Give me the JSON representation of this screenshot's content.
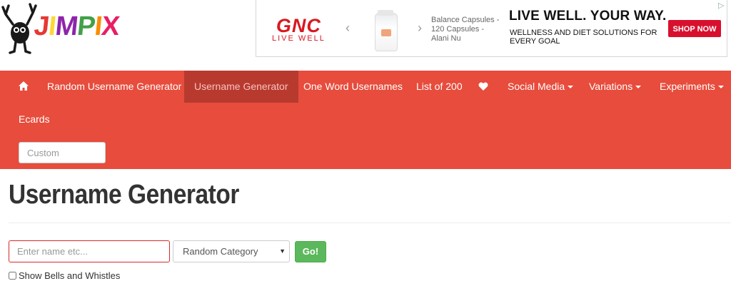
{
  "logo": {
    "letters": [
      "J",
      "I",
      "M",
      "P",
      "I",
      "X"
    ]
  },
  "ad": {
    "brand_main": "GNC",
    "brand_sub": "LIVE WELL",
    "product": "Balance Capsules - 120 Capsules - Alani Nu",
    "headline": "LIVE WELL. YOUR WAY.",
    "subline": "WELLNESS AND DIET SOLUTIONS FOR EVERY GOAL",
    "cta": "SHOP NOW",
    "brand_color": "#d71920"
  },
  "nav": {
    "items": [
      {
        "label": "Random Username Generator"
      },
      {
        "label": "Username Generator"
      },
      {
        "label": "One Word Usernames"
      },
      {
        "label": "List of 200"
      },
      {
        "label": "Social Media"
      },
      {
        "label": "Variations"
      },
      {
        "label": "Experiments"
      },
      {
        "label": "Ecards"
      }
    ],
    "custom_placeholder": "Custom",
    "bg_color": "#e74c3c",
    "active_color": "#b83a2f"
  },
  "main": {
    "title": "Username Generator",
    "name_placeholder": "Enter name etc...",
    "category_selected": "Random Category",
    "go_label": "Go!",
    "bells_label": "Show Bells and Whistles",
    "go_color": "#5cb85c"
  }
}
